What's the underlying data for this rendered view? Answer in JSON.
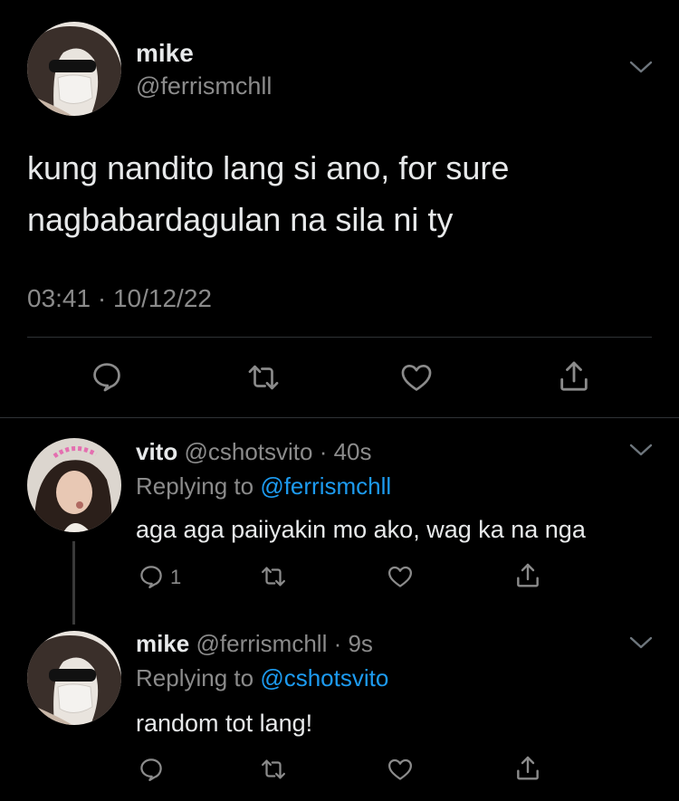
{
  "main_tweet": {
    "display_name": "mike",
    "handle": "@ferrismchll",
    "text_line1": "kung nandito lang si ano, for sure",
    "text_line2": "nagbabardagulan na sila ni ty",
    "time": "03:41",
    "separator": "·",
    "date": "10/12/22"
  },
  "reply1": {
    "display_name": "vito",
    "handle": "@cshotsvito",
    "time": "· 40s",
    "replying_prefix": "Replying to",
    "replying_handle": "@ferrismchll",
    "text": "aga aga paiiyakin mo ako, wag ka na nga",
    "reply_count": "1"
  },
  "reply2": {
    "display_name": "mike",
    "handle": "@ferrismchll",
    "time": "· 9s",
    "replying_prefix": "Replying to",
    "replying_handle": "@cshotsvito",
    "text": "random tot lang!"
  },
  "colors": {
    "background": "#000000",
    "text": "#e7e9ea",
    "muted": "#8b8b8b",
    "link": "#1d9bf0",
    "divider": "#2f3336"
  }
}
